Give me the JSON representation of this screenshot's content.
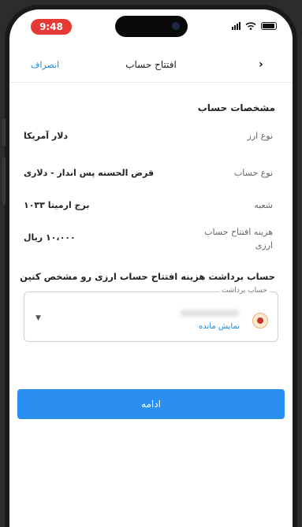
{
  "status_bar": {
    "time": "9:48"
  },
  "nav": {
    "title": "افتتاح حساب",
    "cancel_label": "انصراف",
    "back_icon": "chevron-left"
  },
  "section_title": "مشخصات حساب",
  "details": [
    {
      "label": "نوع ارز",
      "value": "دلار آمریکا"
    },
    {
      "label": "نوع حساب",
      "value": "قرض الحسنه پس انداز - دلاری"
    },
    {
      "label": "شعبه",
      "value": "برج ارمیتا ۱۰۳۳"
    },
    {
      "label_line1": "هزینه افتتاح حساب",
      "label_line2": "ارزی",
      "value": "۱۰،۰۰۰ ریال"
    }
  ],
  "instruction": "حساب برداشت هزینه افتتاح حساب ارزی رو مشخص کنین",
  "withdraw_account": {
    "label": "حساب برداشت",
    "show_balance_label": "نمایش مانده"
  },
  "continue_label": "ادامه",
  "colors": {
    "accent": "#2a8ff0",
    "time_pill": "#e53935"
  }
}
